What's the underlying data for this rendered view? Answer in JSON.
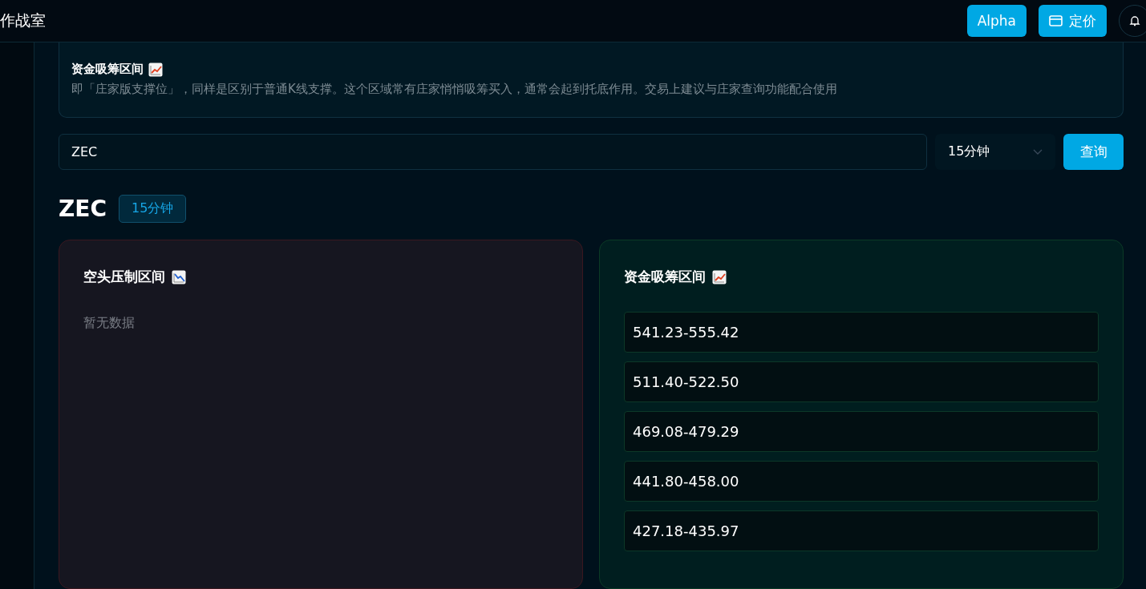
{
  "header": {
    "title": "作战室",
    "buttons": [
      {
        "label": "Alpha",
        "kind": "text"
      },
      {
        "label": "定价",
        "kind": "card"
      }
    ]
  },
  "info": {
    "title": "资金吸筹区间",
    "kind": "support",
    "description": "即「庄家版支撑位」，同样是区别于普通K线支撑。这个区域常有庄家悄悄吸筹买入，通常会起到托底作用。交易上建议与庄家查询功能配合使用"
  },
  "search": {
    "value": "ZEC",
    "interval": "15分钟",
    "button": "查询"
  },
  "result": {
    "symbol": "ZEC",
    "interval": "15分钟"
  },
  "panels": [
    {
      "title": "空头压制区间",
      "kind": "resistance",
      "empty": "暂无数据"
    },
    {
      "title": "资金吸筹区间",
      "kind": "support",
      "ranges": [
        "541.23-555.42",
        "511.40-522.50",
        "469.08-479.29",
        "441.80-458.00",
        "427.18-435.97"
      ]
    }
  ]
}
